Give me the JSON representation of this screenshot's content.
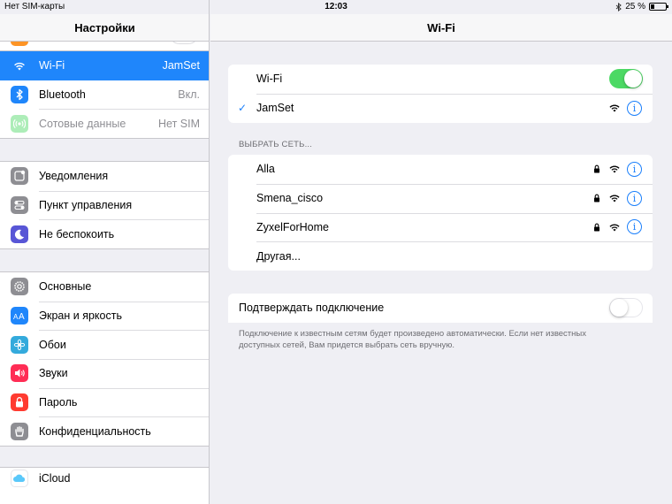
{
  "status": {
    "carrier": "Нет SIM-карты",
    "time": "12:03",
    "battery": "25 %",
    "battery_level": 0.25
  },
  "master": {
    "title": "Настройки",
    "group1": [
      {
        "label": "Wi-Fi",
        "value": "JamSet",
        "icon": "wifi-icon",
        "color": "#1f86fb",
        "selected": true
      },
      {
        "label": "Bluetooth",
        "value": "Вкл.",
        "icon": "bluetooth-icon",
        "color": "#1f86fb"
      },
      {
        "label": "Сотовые данные",
        "value": "Нет SIM",
        "icon": "cellular-icon",
        "color": "#4cd964",
        "disabled": true
      }
    ],
    "group2": [
      {
        "label": "Уведомления",
        "icon": "notifications-icon",
        "color": "#8e8e93"
      },
      {
        "label": "Пункт управления",
        "icon": "control-center-icon",
        "color": "#8e8e93"
      },
      {
        "label": "Не беспокоить",
        "icon": "moon-icon",
        "color": "#5856d6"
      }
    ],
    "group3": [
      {
        "label": "Основные",
        "icon": "gear-icon",
        "color": "#8e8e93"
      },
      {
        "label": "Экран и яркость",
        "icon": "display-brightness-icon",
        "color": "#1f86fb"
      },
      {
        "label": "Обои",
        "icon": "wallpaper-icon",
        "color": "#34aadc"
      },
      {
        "label": "Звуки",
        "icon": "sounds-icon",
        "color": "#ff2d55"
      },
      {
        "label": "Пароль",
        "icon": "lock-icon",
        "color": "#ff3b30"
      },
      {
        "label": "Конфиденциальность",
        "icon": "privacy-hand-icon",
        "color": "#8e8e93"
      }
    ],
    "group4": [
      {
        "label": "iCloud",
        "icon": "icloud-icon",
        "color": "#ffffff"
      }
    ]
  },
  "detail": {
    "title": "Wi-Fi",
    "wifi_label": "Wi-Fi",
    "wifi_enabled": true,
    "connected_network": "JamSet",
    "choose_network_header": "ВЫБРАТЬ СЕТЬ...",
    "networks": [
      {
        "name": "Alla",
        "locked": true
      },
      {
        "name": "Smena_cisco",
        "locked": true
      },
      {
        "name": "ZyxelForHome",
        "locked": true
      }
    ],
    "other_label": "Другая...",
    "ask_to_join_label": "Подтверждать подключение",
    "ask_to_join_enabled": false,
    "ask_to_join_footer": "Подключение к известным сетям будет произведено автоматически. Если нет известных доступных сетей, Вам придется выбрать сеть вручную."
  }
}
